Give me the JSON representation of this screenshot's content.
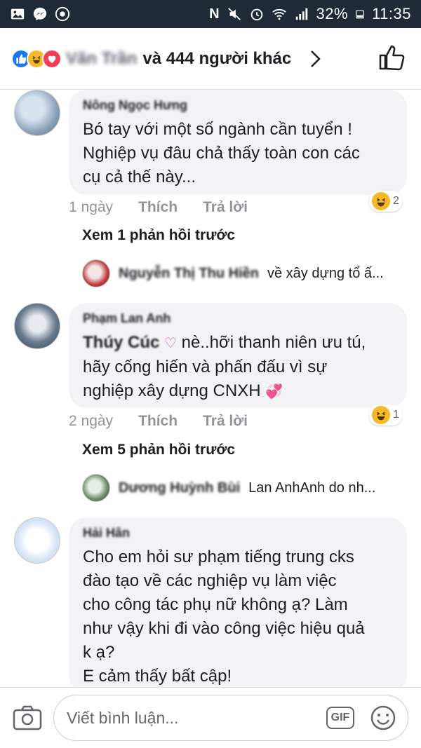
{
  "status_bar": {
    "battery": "32%",
    "time": "11:35"
  },
  "header": {
    "name_blurred": "Văn Trần",
    "title_suffix": "và 444 người khác"
  },
  "comments": [
    {
      "author": "Nông Ngọc Hưng",
      "text": "Bó tay với một số ngành cần tuyển !\nNghiệp vụ đâu chả thấy toàn con các\ncụ cả thế này...",
      "time": "1 ngày",
      "like_label": "Thích",
      "reply_label": "Trả lời",
      "reaction_count": "2",
      "see_previous": "Xem 1 phản hồi trước",
      "reply_preview": {
        "name": "Nguyễn Thị Thu Hiền",
        "text": "về xây dựng tổ ấ..."
      }
    },
    {
      "author": "Phạm Lan Anh",
      "mention": "Thúy Cúc",
      "text_after_mention": " nè..hỡi thanh niên ưu tú,\nhãy cống hiến và phấn đấu vì sự\nnghiệp xây dựng CNXH ",
      "time": "2 ngày",
      "like_label": "Thích",
      "reply_label": "Trả lời",
      "reaction_count": "1",
      "see_previous": "Xem 5 phản hồi trước",
      "reply_preview": {
        "name": "Dương Huỳnh Bùi",
        "text": "Lan AnhAnh do nh..."
      }
    },
    {
      "author": "Hải Hân",
      "text": "Cho em hỏi sư phạm tiếng trung cks\nđào tạo về các nghiệp vụ làm việc\ncho công tác phụ nữ không ạ?  Làm\nnhư vậy khi đi vào công việc hiệu quả\nk ạ?\nE cảm thấy bất cập!"
    }
  ],
  "composer": {
    "placeholder": "Viết bình luận...",
    "gif_label": "GIF"
  },
  "colors": {
    "status_bar": "#1f2a36",
    "bubble": "#f2f3f5",
    "like_blue": "#1877f2",
    "haha_yellow": "#f7b928",
    "love_red": "#f33e58"
  }
}
